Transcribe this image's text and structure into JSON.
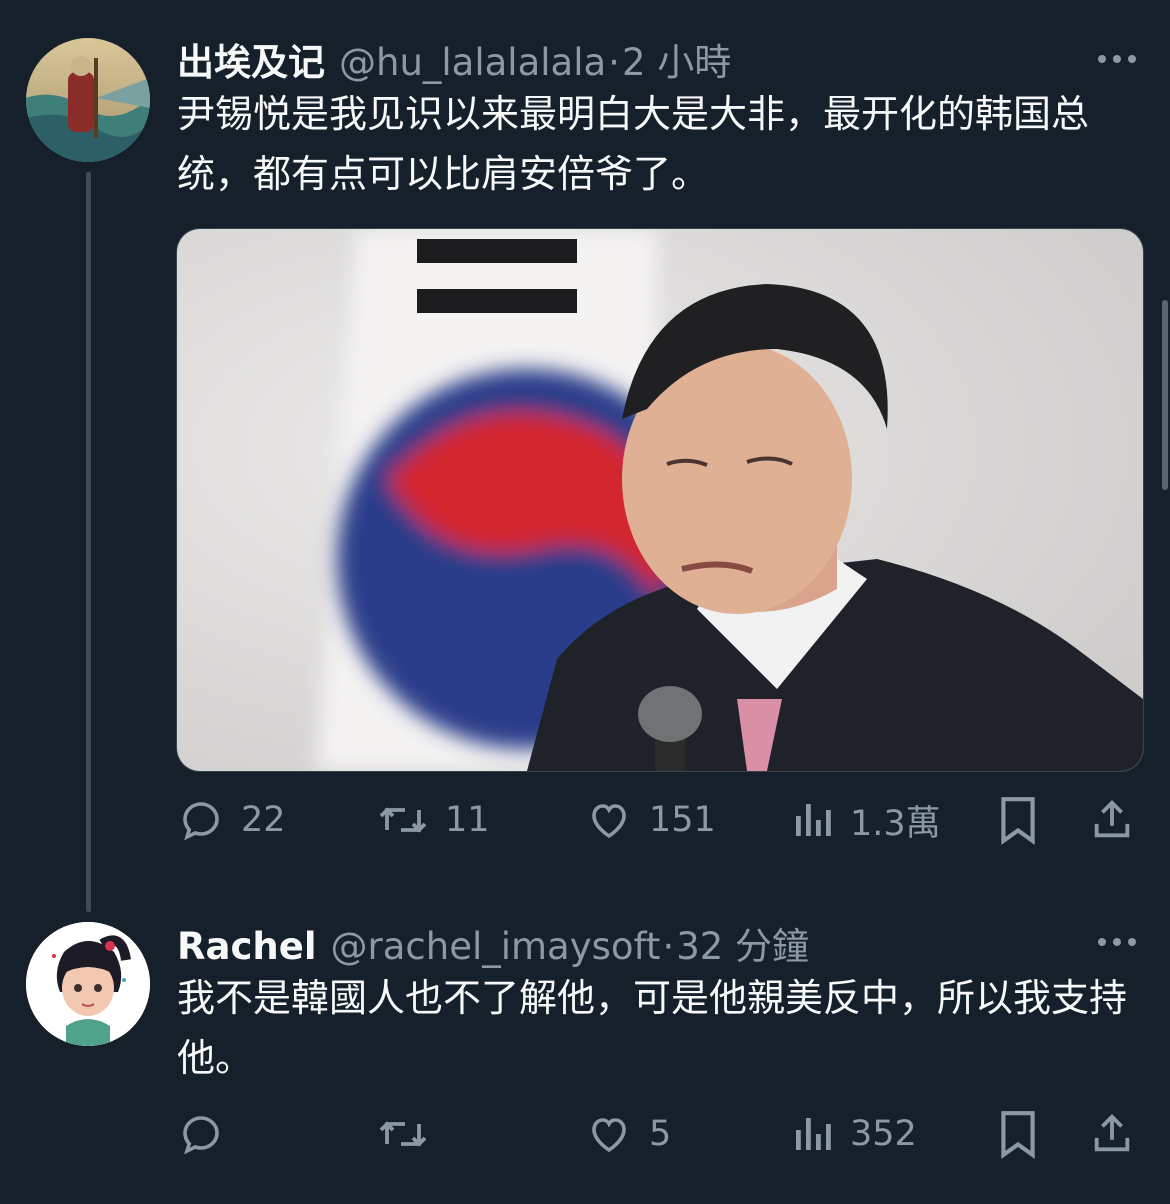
{
  "tweets": [
    {
      "name": "出埃及记",
      "handle": "@hu_lalalalala",
      "separator": "·",
      "time": "2 小時",
      "text": "尹锡悦是我见识以来最明白大是大非，最开化的韩国总统，都有点可以比肩安倍爷了。",
      "has_media": true,
      "stats": {
        "replies": "22",
        "retweets": "11",
        "likes": "151",
        "views": "1.3萬"
      }
    },
    {
      "name": "Rachel",
      "handle": "@rachel_imaysoft",
      "separator": "·",
      "time": "32 分鐘",
      "text": "我不是韓國人也不了解他，可是他親美反中，所以我支持他。",
      "has_media": false,
      "stats": {
        "replies": "",
        "retweets": "",
        "likes": "5",
        "views": "352"
      }
    }
  ],
  "icons": [
    "reply-icon",
    "retweet-icon",
    "like-icon",
    "views-icon",
    "bookmark-icon",
    "share-icon",
    "more-icon"
  ],
  "colors": {
    "background": "#15202b",
    "text": "#f7f9f9",
    "muted": "#8b98a5",
    "divider": "#38444d"
  }
}
